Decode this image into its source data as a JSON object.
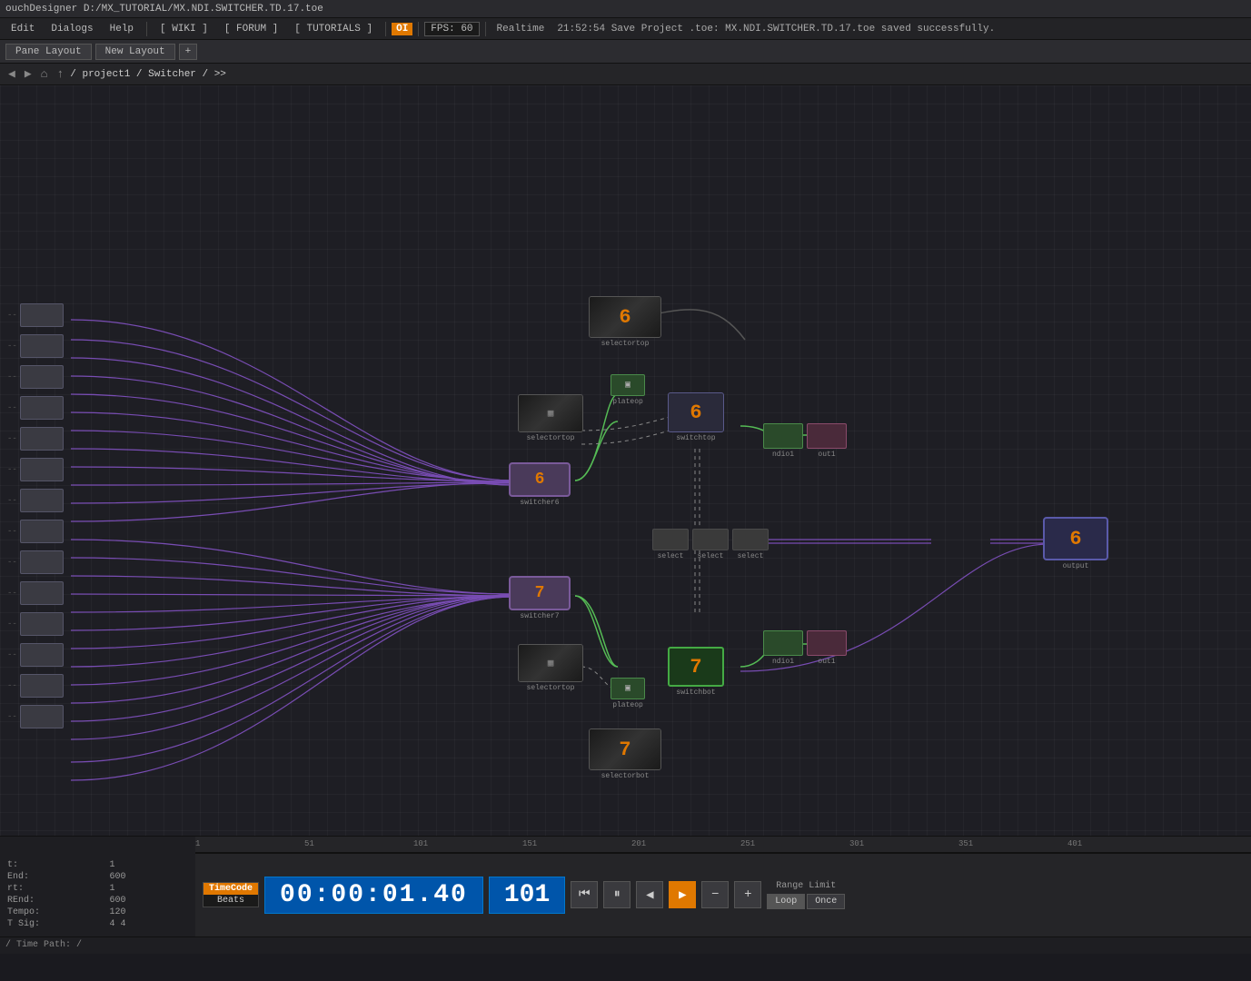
{
  "title_bar": {
    "text": "ouchDesigner D:/MX_TUTORIAL/MX.NDI.SWITCHER.TD.17.toe"
  },
  "menu_bar": {
    "items": [
      "Edit",
      "Dialogs",
      "Help"
    ],
    "wiki": "[ WIKI ]",
    "forum": "[ FORUM ]",
    "tutorials": "[ TUTORIALS ]",
    "oi_badge": "OI",
    "fps_label": "FPS:",
    "fps_value": "60",
    "realtime": "Realtime",
    "status": "21:52:54 Save Project .toe: MX.NDI.SWITCHER.TD.17.toe saved successfully."
  },
  "pane_toolbar": {
    "pane_label": "Pane Layout",
    "new_layout": "New Layout",
    "plus": "+"
  },
  "breadcrumb": {
    "nav": "/ project1 / Switcher / >>"
  },
  "timeline": {
    "marks": [
      "1",
      "51",
      "101",
      "151",
      "201",
      "251",
      "301",
      "351",
      "401"
    ]
  },
  "transport": {
    "timecode_label": "TimeCode",
    "beats_label": "Beats",
    "time_display": "00:00:01.40",
    "frame_display": "101",
    "range_limit": "Range Limit",
    "loop_btn": "Loop",
    "once_btn": "Once"
  },
  "stats": {
    "start_label": "t:",
    "start_val": "1",
    "end_label": "End:",
    "end_val": "600",
    "rt_label": "rt:",
    "rt_val": "1",
    "rend_label": "REnd:",
    "rend_val": "600",
    "tempo_label": "Tempo:",
    "tempo_val": "120",
    "tsig_label": "T Sig:",
    "tsig_val": "4    4"
  },
  "time_path": {
    "label": "/ Time Path: /"
  },
  "nodes": {
    "switcher_6_label": "switcher6",
    "switcher_7_label": "switcher7",
    "preview_6_num": "6",
    "preview_7_num": "7",
    "output_6_num": "6",
    "top_preview_num": "6",
    "bottom_preview_num": "7"
  }
}
